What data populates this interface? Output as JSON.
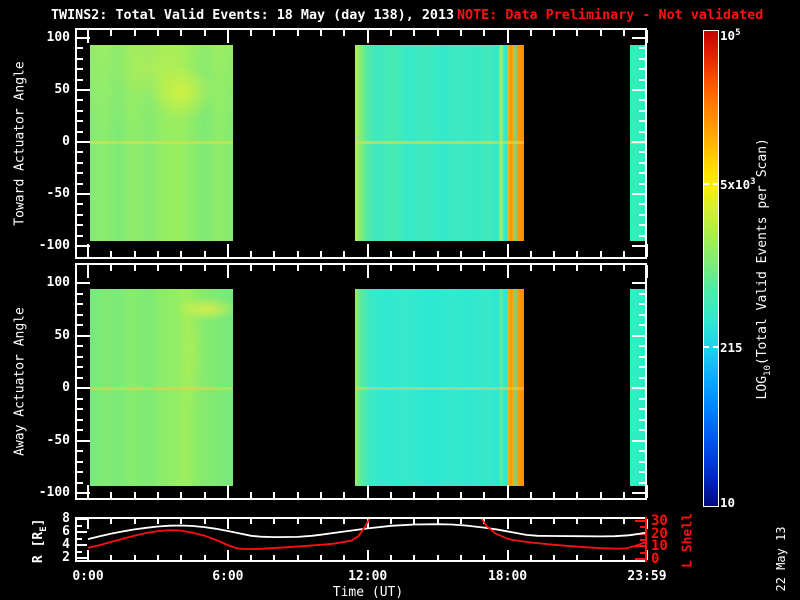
{
  "header": {
    "title": "TWINS2: Total Valid Events: 18 May (day 138), 2013",
    "note": "NOTE: Data Preliminary - Not validated",
    "note_color": "#ff1010"
  },
  "panels": {
    "toward": {
      "ylabel": "Toward Actuator Angle",
      "ytick_labels": [
        "100",
        "50",
        "0",
        "-50",
        "-100"
      ],
      "ytick_values": [
        100,
        50,
        0,
        -50,
        -100
      ]
    },
    "away": {
      "ylabel": "Away Actuator Angle",
      "ytick_labels": [
        "100",
        "50",
        "0",
        "-50",
        "-100"
      ],
      "ytick_values": [
        100,
        50,
        0,
        -50,
        -100
      ]
    },
    "bottom": {
      "ylabel_pre": "R [R",
      "ylabel_sub": "E",
      "ylabel_post": "]",
      "ytick_labels": [
        "8",
        "6",
        "4",
        "2"
      ],
      "ytick_values": [
        8,
        6,
        4,
        2
      ],
      "right_label": "L Shell",
      "right_tick_labels": [
        "30",
        "20",
        "10",
        "0"
      ],
      "right_tick_values": [
        30,
        20,
        10,
        0
      ],
      "right_color": "#ff1010"
    }
  },
  "xaxis": {
    "label": "Time (UT)",
    "ticks": [
      {
        "label": "0:00",
        "h": 0
      },
      {
        "label": "6:00",
        "h": 6
      },
      {
        "label": "12:00",
        "h": 12
      },
      {
        "label": "18:00",
        "h": 18
      },
      {
        "label": "23:59",
        "h": 23.983
      }
    ]
  },
  "colorbar": {
    "title_pre": "LOG",
    "title_sub": "10",
    "title_post": "(Total Valid Events per Scan)",
    "labels": {
      "top": {
        "base": "10",
        "exp": "5"
      },
      "mid1": {
        "base": "5x10",
        "exp": "3"
      },
      "mid2": "215",
      "bottom": "10"
    }
  },
  "footer": {
    "date_stamp": "22 May 13"
  },
  "chart_data": {
    "type": "multi-panel-spectrogram",
    "time_axis": {
      "label": "Time (UT)",
      "range_hours": [
        0,
        23.983
      ],
      "major_tick_hours": [
        0,
        6,
        12,
        18,
        23.983
      ]
    },
    "heatmaps": [
      {
        "id": "toward",
        "title": "Toward Actuator Angle",
        "ylim": [
          -100,
          100
        ],
        "data_angle_extent": [
          -93,
          93
        ],
        "zero_line_color": "rgba(225,225,70,0.55)",
        "segments": [
          {
            "start_h": 0.1,
            "end_h": 6.2,
            "tint_top": "rgba(230,240,60,0.16)",
            "stops": [
              [
                0,
                "#84ea75"
              ],
              [
                0.1,
                "#8cec6e"
              ],
              [
                0.2,
                "#7fe977"
              ],
              [
                0.3,
                "#90ec68"
              ],
              [
                0.42,
                "#85ea72"
              ],
              [
                0.52,
                "#95ed62"
              ],
              [
                0.62,
                "#9aee60"
              ],
              [
                0.72,
                "#8cec6a"
              ],
              [
                0.8,
                "#7de977"
              ],
              [
                0.9,
                "#8eec69"
              ],
              [
                1,
                "#82ea74"
              ]
            ],
            "overlays": [
              {
                "cx": 0.65,
                "cy": 0.24,
                "rx": 0.23,
                "ry": 0.14,
                "color": "rgba(238,242,48,0.6)"
              },
              {
                "cx": 0.45,
                "cy": 0.12,
                "rx": 0.28,
                "ry": 0.16,
                "color": "rgba(220,240,60,0.35)"
              }
            ]
          },
          {
            "start_h": 11.45,
            "end_h": 18.7,
            "stops": [
              [
                0,
                "#b6ee58"
              ],
              [
                0.03,
                "#8cec6c"
              ],
              [
                0.07,
                "#55eaa4"
              ],
              [
                0.13,
                "#3ee9c0"
              ],
              [
                0.22,
                "#48eab2"
              ],
              [
                0.32,
                "#36e9c8"
              ],
              [
                0.42,
                "#40eabc"
              ],
              [
                0.52,
                "#34e9ca"
              ],
              [
                0.62,
                "#3de9c2"
              ],
              [
                0.72,
                "#37e9c7"
              ],
              [
                0.79,
                "#44eab8"
              ],
              [
                0.845,
                "#2ee8cd"
              ],
              [
                0.865,
                "#aaee5e"
              ],
              [
                0.885,
                "#36e9c6"
              ],
              [
                0.9,
                "#2ee8cd"
              ],
              [
                0.908,
                "#ffb404"
              ],
              [
                0.922,
                "#ff9000"
              ],
              [
                0.938,
                "#ffae00"
              ],
              [
                0.95,
                "#2ee8cc"
              ],
              [
                0.962,
                "#ff9c00"
              ],
              [
                1,
                "#ff8c00"
              ]
            ],
            "overlays": []
          },
          {
            "start_h": 23.27,
            "end_h": 23.9,
            "stops": [
              [
                0,
                "#36efb6"
              ],
              [
                1,
                "#2feac0"
              ]
            ],
            "overlays": []
          }
        ]
      },
      {
        "id": "away",
        "title": "Away Actuator Angle",
        "ylim": [
          -100,
          100
        ],
        "data_angle_extent": [
          -93,
          93
        ],
        "zero_line_color": "rgba(250,205,70,0.5)",
        "segments": [
          {
            "start_h": 0.1,
            "end_h": 6.2,
            "stops": [
              [
                0,
                "#74e97e"
              ],
              [
                0.1,
                "#82ea73"
              ],
              [
                0.2,
                "#7bea79"
              ],
              [
                0.3,
                "#88ec6e"
              ],
              [
                0.4,
                "#7eea76"
              ],
              [
                0.5,
                "#8aec6c"
              ],
              [
                0.6,
                "#92ed64"
              ],
              [
                0.68,
                "#9eee5e"
              ],
              [
                0.74,
                "#8cec68"
              ],
              [
                0.82,
                "#84ea70"
              ],
              [
                0.92,
                "#7cea76"
              ],
              [
                1,
                "#76e97b"
              ]
            ],
            "overlays": [
              {
                "cx": 0.82,
                "cy": 0.1,
                "rx": 0.22,
                "ry": 0.06,
                "color": "rgba(225,238,70,0.85)"
              },
              {
                "cx": 0.72,
                "cy": 0.3,
                "rx": 0.07,
                "ry": 0.32,
                "color": "rgba(210,238,70,0.3)"
              }
            ]
          },
          {
            "start_h": 11.45,
            "end_h": 18.7,
            "stops": [
              [
                0,
                "#98ed60"
              ],
              [
                0.03,
                "#64ea94"
              ],
              [
                0.08,
                "#3ee9c4"
              ],
              [
                0.18,
                "#2ee9d0"
              ],
              [
                0.3,
                "#38e9ca"
              ],
              [
                0.45,
                "#2ce8d2"
              ],
              [
                0.58,
                "#34e9cc"
              ],
              [
                0.68,
                "#2ee8d0"
              ],
              [
                0.78,
                "#38e9c8"
              ],
              [
                0.845,
                "#2ce8d2"
              ],
              [
                0.865,
                "#62ea98"
              ],
              [
                0.885,
                "#30e9ce"
              ],
              [
                0.9,
                "#2ee8d0"
              ],
              [
                0.908,
                "#ffb404"
              ],
              [
                0.922,
                "#ff9400"
              ],
              [
                0.938,
                "#ffae00"
              ],
              [
                0.95,
                "#30e9cc"
              ],
              [
                0.962,
                "#ffa000"
              ],
              [
                1,
                "#ff8c00"
              ]
            ],
            "overlays": []
          },
          {
            "start_h": 23.27,
            "end_h": 23.9,
            "stops": [
              [
                0,
                "#30f0c0"
              ],
              [
                1,
                "#2deac6"
              ]
            ],
            "overlays": []
          }
        ]
      }
    ],
    "line_chart": {
      "id": "orbit",
      "series": [
        {
          "name": "R [RE]",
          "color": "#ffffff",
          "axis": "left",
          "ylim": [
            2,
            8
          ],
          "points": [
            [
              0,
              4.9
            ],
            [
              0.5,
              5.35
            ],
            [
              1,
              5.75
            ],
            [
              1.5,
              6.1
            ],
            [
              2,
              6.4
            ],
            [
              2.5,
              6.65
            ],
            [
              3,
              6.85
            ],
            [
              3.5,
              6.97
            ],
            [
              4,
              7.0
            ],
            [
              4.5,
              6.92
            ],
            [
              5,
              6.75
            ],
            [
              5.5,
              6.5
            ],
            [
              6,
              6.15
            ],
            [
              6.5,
              5.78
            ],
            [
              7,
              5.42
            ],
            [
              7.4,
              5.28
            ],
            [
              8,
              5.22
            ],
            [
              9,
              5.25
            ],
            [
              9.6,
              5.42
            ],
            [
              10,
              5.58
            ],
            [
              11,
              6.08
            ],
            [
              12,
              6.55
            ],
            [
              13,
              6.95
            ],
            [
              14,
              7.15
            ],
            [
              15,
              7.2
            ],
            [
              15.6,
              7.15
            ],
            [
              16.2,
              7.0
            ],
            [
              17,
              6.68
            ],
            [
              17.6,
              6.35
            ],
            [
              18.2,
              5.95
            ],
            [
              18.8,
              5.55
            ],
            [
              19.3,
              5.42
            ],
            [
              20,
              5.38
            ],
            [
              21,
              5.35
            ],
            [
              22,
              5.32
            ],
            [
              22.6,
              5.35
            ],
            [
              23.2,
              5.5
            ],
            [
              23.6,
              5.7
            ],
            [
              23.98,
              5.92
            ]
          ]
        },
        {
          "name": "L Shell",
          "color": "#ff1010",
          "axis": "right",
          "ylim": [
            0,
            30
          ],
          "points": [
            [
              0,
              8.8
            ],
            [
              0.5,
              11
            ],
            [
              1,
              13.5
            ],
            [
              1.5,
              16
            ],
            [
              2,
              18.5
            ],
            [
              2.5,
              20.5
            ],
            [
              3,
              22
            ],
            [
              3.5,
              22.8
            ],
            [
              4,
              22.4
            ],
            [
              4.5,
              20.8
            ],
            [
              5,
              18.4
            ],
            [
              5.5,
              15
            ],
            [
              6,
              11
            ],
            [
              6.4,
              8.4
            ],
            [
              6.8,
              7.8
            ],
            [
              7.5,
              8.1
            ],
            [
              8.5,
              9.2
            ],
            [
              9.5,
              10.5
            ],
            [
              10.5,
              12
            ],
            [
              11.3,
              14.5
            ],
            [
              11.6,
              18
            ],
            [
              11.9,
              26
            ],
            [
              12.2,
              36
            ],
            [
              12.35,
              44
            ],
            [
              16.55,
              44
            ],
            [
              16.8,
              34
            ],
            [
              17.1,
              26
            ],
            [
              17.5,
              20
            ],
            [
              18,
              16
            ],
            [
              18.3,
              14.8
            ],
            [
              19,
              13
            ],
            [
              20,
              11.2
            ],
            [
              21,
              9.7
            ],
            [
              22,
              8.6
            ],
            [
              22.7,
              8.1
            ],
            [
              23.1,
              8.4
            ],
            [
              23.5,
              10.5
            ],
            [
              23.8,
              12.5
            ],
            [
              23.98,
              13.2
            ]
          ]
        }
      ]
    },
    "colorbar": {
      "scale": "log10",
      "min": 10,
      "max": 100000,
      "labeled_values": [
        100000,
        5000,
        215,
        10
      ],
      "tick_values": [
        5000,
        215
      ],
      "stops": [
        [
          0,
          "#c80000"
        ],
        [
          0.05,
          "#e42000"
        ],
        [
          0.1,
          "#fa4c00"
        ],
        [
          0.15,
          "#ff7800"
        ],
        [
          0.2,
          "#ff9c00"
        ],
        [
          0.25,
          "#ffc000"
        ],
        [
          0.3,
          "#ffe400"
        ],
        [
          0.33,
          "#f8f000"
        ],
        [
          0.37,
          "#d8ee2c"
        ],
        [
          0.43,
          "#a6ee4e"
        ],
        [
          0.49,
          "#7cec78"
        ],
        [
          0.55,
          "#4eeaaa"
        ],
        [
          0.61,
          "#30e9d0"
        ],
        [
          0.67,
          "#1cd2ee"
        ],
        [
          0.73,
          "#0cacff"
        ],
        [
          0.79,
          "#0084ff"
        ],
        [
          0.85,
          "#005cf4"
        ],
        [
          0.91,
          "#0038dc"
        ],
        [
          0.96,
          "#001cae"
        ],
        [
          1,
          "#000c74"
        ]
      ]
    }
  }
}
